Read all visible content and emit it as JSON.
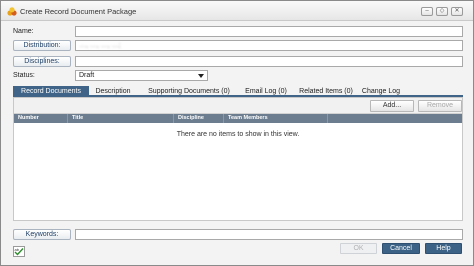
{
  "window": {
    "title": "Create Record Document Package",
    "buttons": {
      "minimize": "–",
      "restore": "◇",
      "close": "✕"
    }
  },
  "form": {
    "name_label": "Name:",
    "name_value": "",
    "distribution_label": "Distribution:",
    "distribution_value": "…, …, …, …;",
    "disciplines_label": "Disciplines:",
    "disciplines_value": "",
    "status_label": "Status:",
    "status_value": "Draft",
    "keywords_label": "Keywords:",
    "keywords_value": ""
  },
  "tabs": [
    {
      "label": "Record Documents",
      "active": true
    },
    {
      "label": "Description"
    },
    {
      "label": "Supporting Documents (0)"
    },
    {
      "label": "Email Log (0)"
    },
    {
      "label": "Related Items (0)"
    },
    {
      "label": "Change Log"
    }
  ],
  "toolbar": {
    "add_label": "Add...",
    "remove_label": "Remove"
  },
  "table": {
    "columns": [
      "Number",
      "Title",
      "Discipline",
      "Team Members"
    ],
    "empty_message": "There are no items to show in this view."
  },
  "footer": {
    "ok_label": "OK",
    "cancel_label": "Cancel",
    "help_label": "Help"
  },
  "colors": {
    "accent": "#3f6487",
    "header": "#6b7d8f"
  }
}
